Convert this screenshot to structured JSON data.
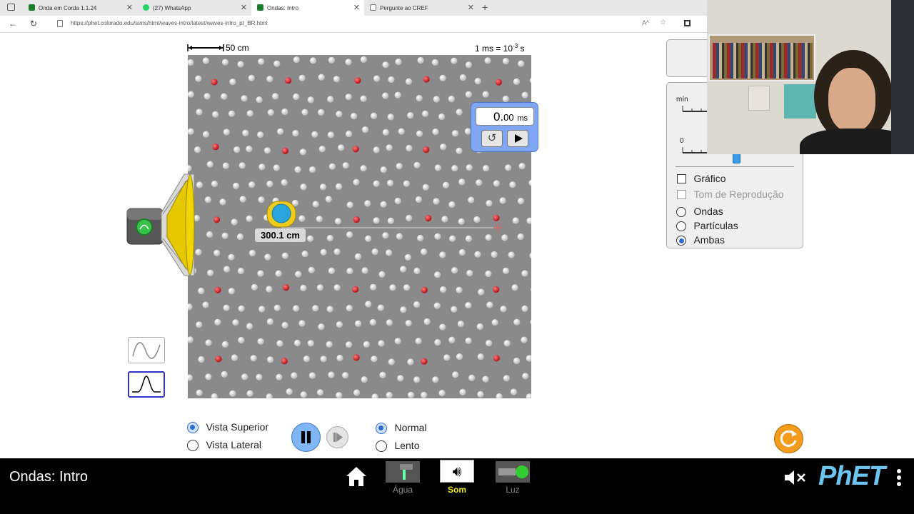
{
  "browser": {
    "tabs": [
      {
        "title": "Onda em Corda 1.1.24",
        "color": "#1a7d2b",
        "active": false
      },
      {
        "title": "(27) WhatsApp",
        "color": "#25d366",
        "active": false
      },
      {
        "title": "Ondas: Intro",
        "color": "#1a7d2b",
        "active": true
      },
      {
        "title": "Pergunte ao CREF",
        "color": "#888888",
        "active": false
      }
    ],
    "url": "https://phet.colorado.edu/sims/html/waves-intro/latest/waves-intro_pt_BR.html"
  },
  "sim": {
    "scale_label": "50 cm",
    "time_scale_prefix": "1 ms = 10",
    "time_scale_exp": "-3",
    "time_scale_suffix": " s",
    "stopwatch": {
      "value_main": "0.",
      "value_dec": "00",
      "unit": "ms"
    },
    "tape_measure_value": "300.1 cm",
    "view_options": [
      {
        "label": "Vista Superior",
        "selected": true
      },
      {
        "label": "Vista Lateral",
        "selected": false
      }
    ],
    "speed_options": [
      {
        "label": "Normal",
        "selected": true
      },
      {
        "label": "Lento",
        "selected": false
      }
    ],
    "panel": {
      "slider_min_label": "mín",
      "slider_zero_label": "0",
      "checkboxes": [
        {
          "label": "Gráfico",
          "enabled": true,
          "checked": false
        },
        {
          "label": "Tom de Reprodução",
          "enabled": false,
          "checked": false
        }
      ],
      "radios": [
        {
          "label": "Ondas",
          "selected": false
        },
        {
          "label": "Partículas",
          "selected": false
        },
        {
          "label": "Ambas",
          "selected": true
        }
      ]
    }
  },
  "navbar": {
    "title": "Ondas: Intro",
    "screens": [
      {
        "label": "Água",
        "active": false
      },
      {
        "label": "Som",
        "active": true
      },
      {
        "label": "Luz",
        "active": false
      }
    ],
    "brand": "PhET"
  },
  "colors": {
    "particle": "#e8e8e8",
    "tracer": "#d6202c",
    "wave_bg": "#8a8a8a",
    "accent": "#2b6cd1",
    "phet_blue": "#6cc5f0"
  }
}
